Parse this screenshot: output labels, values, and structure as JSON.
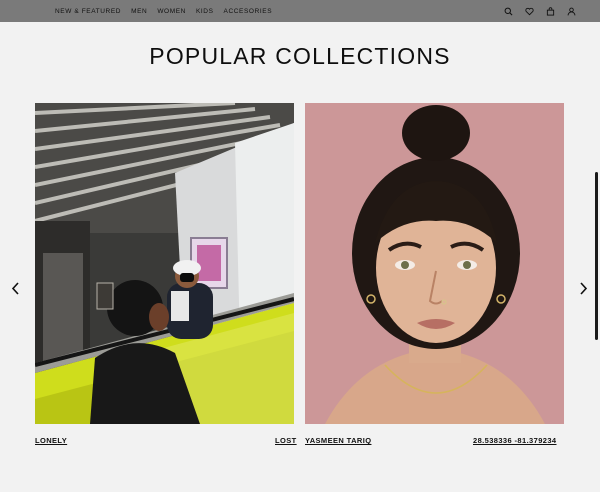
{
  "nav": {
    "items": [
      "NEW & FEATURED",
      "MEN",
      "WOMEN",
      "KIDS",
      "ACCESORIES"
    ]
  },
  "icons": {
    "search": "search-icon",
    "wishlist": "heart-icon",
    "bag": "bag-icon",
    "account": "user-icon"
  },
  "section": {
    "title": "POPULAR COLLECTIONS"
  },
  "collections": [
    {
      "left_label": "LONELY",
      "right_label": "LOST"
    },
    {
      "left_label": "YASMEEN TARIQ",
      "right_label": "28.538336 -81.379234"
    }
  ],
  "colors": {
    "topbar": "#7a7a7a",
    "background": "#f2f2f2",
    "photo_pink": "#c99596",
    "escalator_yellow": "#d6e400"
  }
}
